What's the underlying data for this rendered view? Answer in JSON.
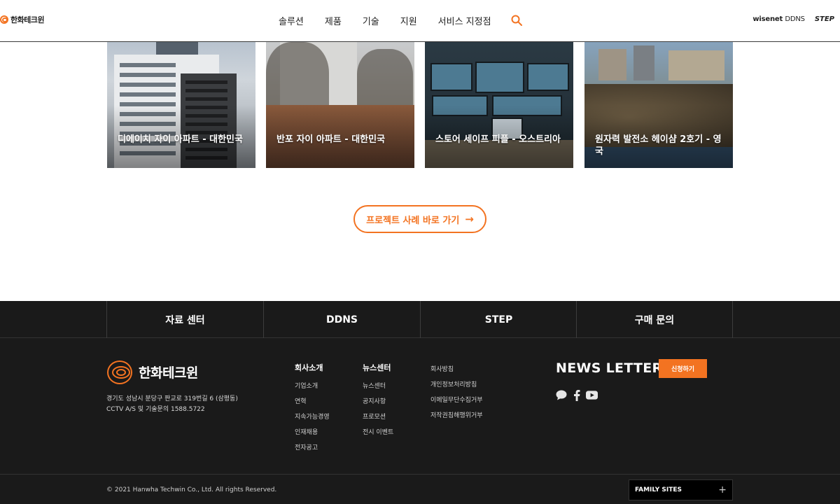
{
  "header": {
    "logo_text": "한화테크윈",
    "nav": [
      "솔루션",
      "제품",
      "기술",
      "지원",
      "서비스 지정점"
    ],
    "wisenet_brand": "wisenet",
    "wisenet_ddns": "DDNS",
    "step_label": "STEP"
  },
  "projects": [
    {
      "title": "디에이치 자이 아파트 - 대한민국"
    },
    {
      "title": "반포 자이 아파트 - 대한민국"
    },
    {
      "title": "스토어 세이프 피플 - 오스트리아"
    },
    {
      "title": "원자력 발전소 헤이샴 2호기 - 영국"
    }
  ],
  "cta": {
    "label": "프로젝트 사례 바로 가기",
    "arrow": "→"
  },
  "quickbar": [
    "자료 센터",
    "DDNS",
    "STEP",
    "구매 문의"
  ],
  "footer": {
    "logo_text": "한화테크윈",
    "address_line1": "경기도 성남시 분당구 판교로 319번길 6 (삼평동)",
    "address_line2": "CCTV A/S 및 기술문의 1588.5722",
    "col1": {
      "head": "회사소개",
      "links": [
        "기업소개",
        "연혁",
        "지속가능경영",
        "인재채용",
        "전자공고"
      ]
    },
    "col2": {
      "head": "뉴스센터",
      "links": [
        "뉴스센터",
        "공지사항",
        "프로모션",
        "전시 이벤트"
      ]
    },
    "col3": {
      "links": [
        "회사방침",
        "개인정보처리방침",
        "이메일무단수집거부",
        "저작권침해행위거부"
      ]
    },
    "newsletter_title": "NEWS LETTER",
    "subscribe_label": "신청하기",
    "copyright": "© 2021 Hanwha Techwin Co., Ltd. All rights Reserved.",
    "family_sites": "FAMILY SITES",
    "family_plus": "+"
  },
  "colors": {
    "accent": "#f37321",
    "footer_bg": "#1a1a1a"
  }
}
